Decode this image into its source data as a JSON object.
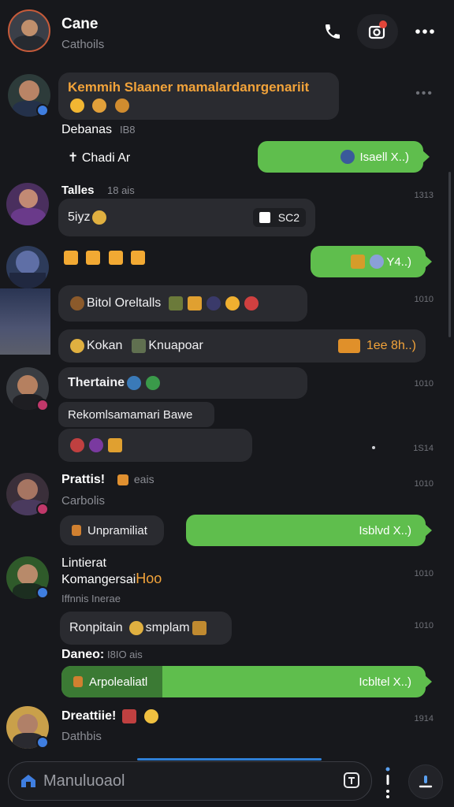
{
  "header": {
    "title": "Cane",
    "subtitle": "Cathoils",
    "icons": [
      "phone-icon",
      "camera-icon",
      "more-icon"
    ]
  },
  "rows": [
    {
      "title": "Kemmih Slaaner mamalardanrgenariit",
      "line2": "Debanas",
      "line2_extra": "IB8",
      "reply": "Chadi Ar",
      "out": "Isaell X..)",
      "time": ""
    },
    {
      "name": "Talles",
      "meta": "18 ais",
      "msg": "5iyz",
      "chip": "SC2",
      "time": "1313"
    },
    {
      "out": "Y4..)",
      "msg1": "Bitol Oreltalls",
      "msg2": "Kokan",
      "msg2b": "Knuapoar",
      "out2": "1ee 8h..)",
      "time1": "1010"
    },
    {
      "name": "Thertaine",
      "msg1": "Rekomlsamamari Bawe",
      "time1": "1010",
      "time2": "1S14"
    },
    {
      "name": "Prattis!",
      "meta": "eais",
      "sub": "Carbolis",
      "msg": "Unpramiliat",
      "out": "Isblvd X..)",
      "time": "1010"
    },
    {
      "name": "Lintierat",
      "name2": "Komangersai",
      "name2_extra": "Hoo",
      "meta": "Iffnnis Inerae",
      "msg": "Ronpitain",
      "msg_extra": "smplam",
      "time1": "1010",
      "time2": "1010"
    },
    {
      "meta_label": "Daneo:",
      "meta_extra": "I8IO ais",
      "msg": "Arpolealiatl",
      "out": "Icbltel X..)"
    },
    {
      "name": "Dreattiie!",
      "sub": "Dathbis",
      "time": "1914"
    }
  ],
  "composer": {
    "placeholder": "Manuluoaol"
  },
  "colors": {
    "background": "#17181c",
    "bubble_in": "#2a2b30",
    "bubble_out": "#5fbe4d",
    "accent_blue": "#2f7fd6",
    "notification_red": "#e2463a",
    "highlight_orange": "#f2a33a"
  }
}
